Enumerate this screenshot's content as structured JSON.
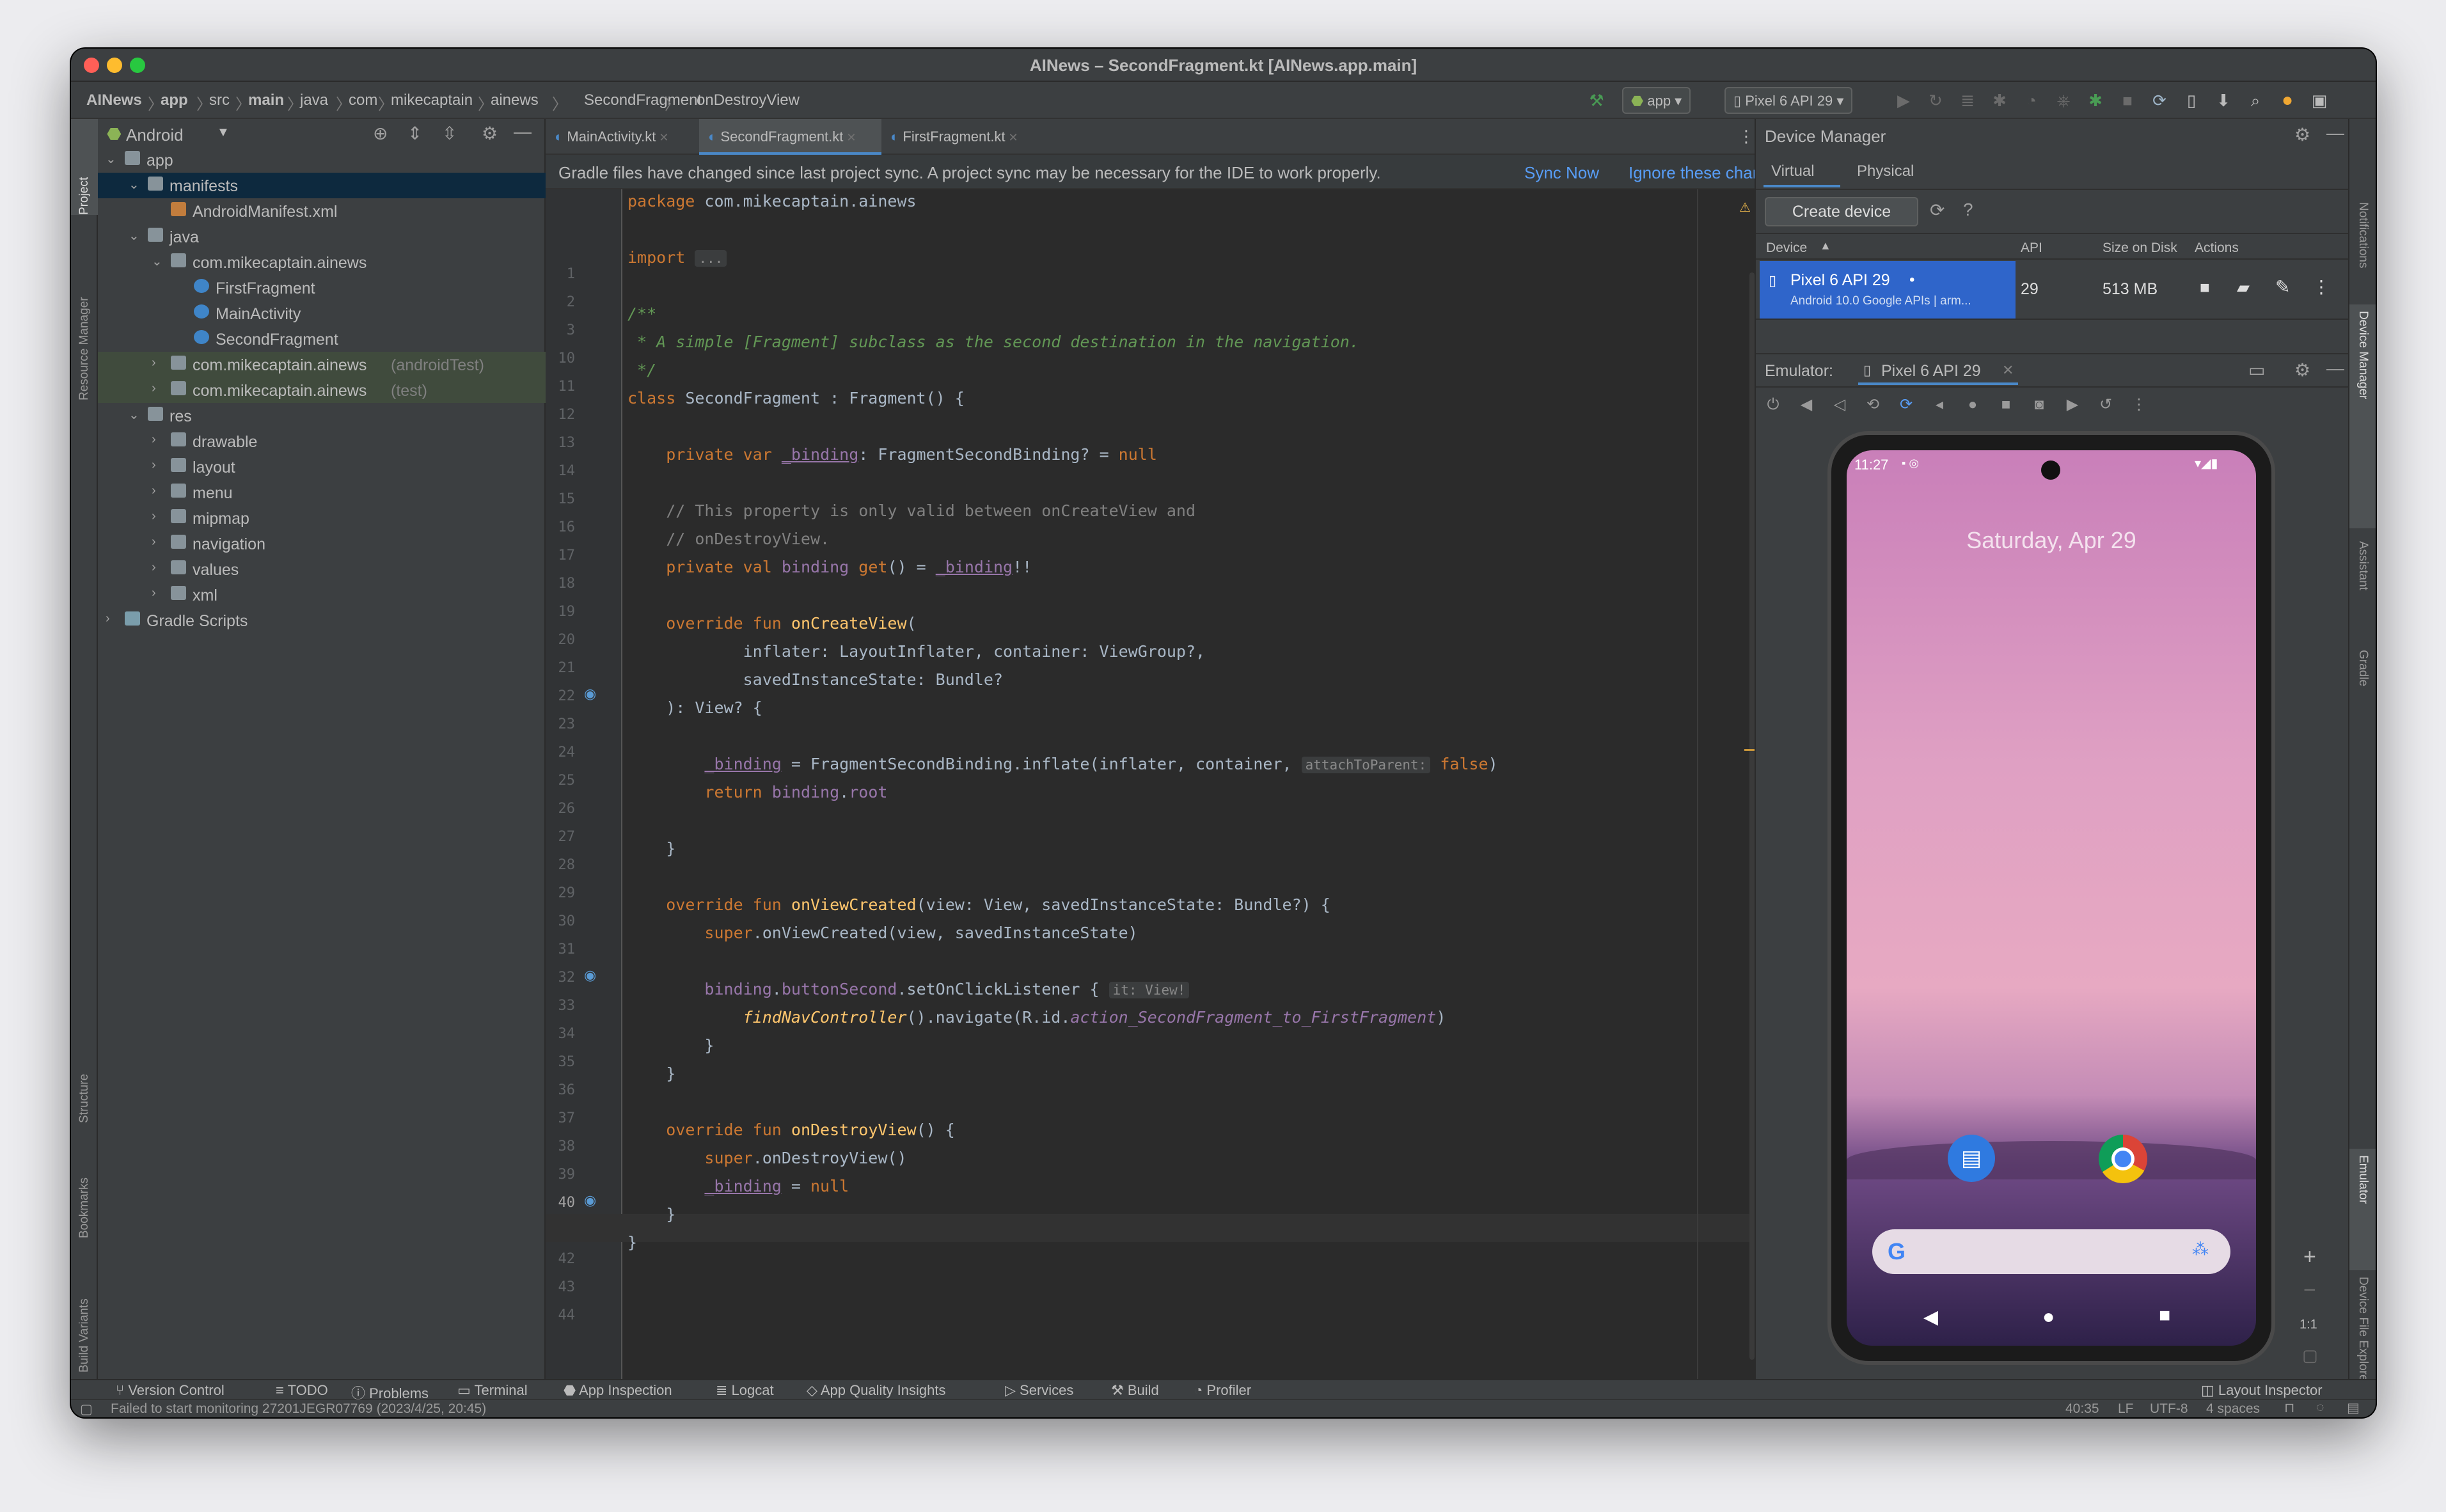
{
  "window": {
    "title": "AINews – SecondFragment.kt [AINews.app.main]"
  },
  "breadcrumbs": [
    "AINews",
    "app",
    "src",
    "main",
    "java",
    "com",
    "mikecaptain",
    "ainews",
    "SecondFragment",
    "onDestroyView"
  ],
  "run_config": "app",
  "device_selector": "Pixel 6 API 29",
  "left_tools": [
    "Project",
    "Resource Manager",
    "Structure",
    "Bookmarks",
    "Build Variants"
  ],
  "right_tools": [
    "Notifications",
    "Device Manager",
    "Assistant",
    "Gradle",
    "Emulator",
    "Device File Explorer"
  ],
  "project": {
    "view": "Android",
    "tree": [
      {
        "label": "app",
        "suffix": "",
        "depth": 0,
        "open": "v",
        "icon": "folder"
      },
      {
        "label": "manifests",
        "suffix": "",
        "depth": 1,
        "open": "v",
        "icon": "folder"
      },
      {
        "label": "AndroidManifest.xml",
        "suffix": "",
        "depth": 2,
        "open": "",
        "icon": "xml"
      },
      {
        "label": "java",
        "suffix": "",
        "depth": 1,
        "open": "v",
        "icon": "folder"
      },
      {
        "label": "com.mikecaptain.ainews",
        "suffix": "",
        "depth": 2,
        "open": "v",
        "icon": "folder"
      },
      {
        "label": "FirstFragment",
        "suffix": "",
        "depth": 3,
        "open": "",
        "icon": "kt"
      },
      {
        "label": "MainActivity",
        "suffix": "",
        "depth": 3,
        "open": "",
        "icon": "kt"
      },
      {
        "label": "SecondFragment",
        "suffix": "",
        "depth": 3,
        "open": "",
        "icon": "kt"
      },
      {
        "label": "com.mikecaptain.ainews",
        "suffix": "(androidTest)",
        "depth": 2,
        "open": ">",
        "icon": "folder"
      },
      {
        "label": "com.mikecaptain.ainews",
        "suffix": "(test)",
        "depth": 2,
        "open": ">",
        "icon": "folder"
      },
      {
        "label": "res",
        "suffix": "",
        "depth": 1,
        "open": "v",
        "icon": "folder"
      },
      {
        "label": "drawable",
        "suffix": "",
        "depth": 2,
        "open": ">",
        "icon": "folder"
      },
      {
        "label": "layout",
        "suffix": "",
        "depth": 2,
        "open": ">",
        "icon": "folder"
      },
      {
        "label": "menu",
        "suffix": "",
        "depth": 2,
        "open": ">",
        "icon": "folder"
      },
      {
        "label": "mipmap",
        "suffix": "",
        "depth": 2,
        "open": ">",
        "icon": "folder"
      },
      {
        "label": "navigation",
        "suffix": "",
        "depth": 2,
        "open": ">",
        "icon": "folder"
      },
      {
        "label": "values",
        "suffix": "",
        "depth": 2,
        "open": ">",
        "icon": "folder"
      },
      {
        "label": "xml",
        "suffix": "",
        "depth": 2,
        "open": ">",
        "icon": "folder"
      },
      {
        "label": "Gradle Scripts",
        "suffix": "",
        "depth": 0,
        "open": ">",
        "icon": "gradle"
      }
    ]
  },
  "tabs": [
    {
      "label": "MainActivity.kt",
      "active": false
    },
    {
      "label": "SecondFragment.kt",
      "active": true
    },
    {
      "label": "FirstFragment.kt",
      "active": false
    }
  ],
  "notice": {
    "text": "Gradle files have changed since last project sync. A project sync may be necessary for the IDE to work properly.",
    "sync": "Sync Now",
    "ignore": "Ignore these changes"
  },
  "warnings": "1",
  "code": [
    {
      "n": "1",
      "html": "<span class='kw'>package</span> com.mikecaptain.ainews"
    },
    {
      "n": "2",
      "html": ""
    },
    {
      "n": "3",
      "html": "<span class='kw'>import</span> <span class='hint'>...</span>"
    },
    {
      "n": "10",
      "html": ""
    },
    {
      "n": "11",
      "html": "<span class='dc'>/**</span>"
    },
    {
      "n": "12",
      "html": "<span class='dc'> * A simple [Fragment] subclass as the second destination in the navigation.</span>"
    },
    {
      "n": "13",
      "html": "<span class='dc'> */</span>"
    },
    {
      "n": "14",
      "html": "<span class='kw'>class</span> SecondFragment : Fragment() {"
    },
    {
      "n": "15",
      "html": ""
    },
    {
      "n": "16",
      "html": "    <span class='kw'>private var</span> <span class='pr un'>_binding</span>: FragmentSecondBinding? = <span class='kw'>null</span>"
    },
    {
      "n": "17",
      "html": ""
    },
    {
      "n": "18",
      "html": "    <span class='cm'>// This property is only valid between onCreateView and</span>"
    },
    {
      "n": "19",
      "html": "    <span class='cm'>// onDestroyView.</span>"
    },
    {
      "n": "20",
      "html": "    <span class='kw'>private val</span> <span class='pr'>binding</span> <span class='kw'>get</span>() = <span class='pr un'>_binding</span>!!"
    },
    {
      "n": "21",
      "html": ""
    },
    {
      "n": "22",
      "html": "    <span class='kw'>override fun</span> <span class='fn'>onCreateView</span>("
    },
    {
      "n": "23",
      "html": "            inflater: LayoutInflater, container: ViewGroup?,"
    },
    {
      "n": "24",
      "html": "            savedInstanceState: Bundle?"
    },
    {
      "n": "25",
      "html": "    ): View? {"
    },
    {
      "n": "26",
      "html": ""
    },
    {
      "n": "27",
      "html": "        <span class='pr un'>_binding</span> = FragmentSecondBinding.inflate(inflater, container, <span class='hint'>attachToParent:</span> <span class='kw'>false</span>)"
    },
    {
      "n": "28",
      "html": "        <span class='kw'>return</span> <span class='pr'>binding</span>.<span class='pr'>root</span>"
    },
    {
      "n": "29",
      "html": ""
    },
    {
      "n": "30",
      "html": "    }"
    },
    {
      "n": "31",
      "html": ""
    },
    {
      "n": "32",
      "html": "    <span class='kw'>override fun</span> <span class='fn'>onViewCreated</span>(view: View, savedInstanceState: Bundle?) {"
    },
    {
      "n": "33",
      "html": "        <span class='kw'>super</span>.onViewCreated(view, savedInstanceState)"
    },
    {
      "n": "34",
      "html": ""
    },
    {
      "n": "35",
      "html": "        <span class='pr'>binding</span>.<span class='pr'>buttonSecond</span>.setOnClickListener { <span class='hint'>it: View!</span>"
    },
    {
      "n": "36",
      "html": "            <span class='fn it'>findNavController</span>().navigate(R.id.<span class='pr it'>action_SecondFragment_to_FirstFragment</span>)"
    },
    {
      "n": "37",
      "html": "        }"
    },
    {
      "n": "38",
      "html": "    }"
    },
    {
      "n": "39",
      "html": ""
    },
    {
      "n": "40",
      "html": "    <span class='kw'>override fun</span> <span class='fn'>onDestroyView</span>() {"
    },
    {
      "n": "41",
      "html": "        <span class='kw'>super</span>.onDestroyView()"
    },
    {
      "n": "42",
      "html": "        <span class='pr un'>_binding</span> = <span class='kw'>null</span>"
    },
    {
      "n": "43",
      "html": "    }"
    },
    {
      "n": "44",
      "html": "}"
    }
  ],
  "device_manager": {
    "title": "Device Manager",
    "tab_virtual": "Virtual",
    "tab_physical": "Physical",
    "create": "Create device",
    "col_device": "Device",
    "col_api": "API",
    "col_size": "Size on Disk",
    "col_actions": "Actions",
    "device_name": "Pixel 6 API 29",
    "device_sub": "Android 10.0 Google APIs | arm...",
    "api": "29",
    "size": "513 MB"
  },
  "emulator": {
    "label": "Emulator:",
    "tab": "Pixel 6 API 29",
    "time": "11:27",
    "date": "Saturday, Apr 29",
    "zoom_ratio": "1:1"
  },
  "bottom_tools": [
    "Version Control",
    "TODO",
    "Problems",
    "Terminal",
    "App Inspection",
    "Logcat",
    "App Quality Insights",
    "Services",
    "Build",
    "Profiler"
  ],
  "layout_inspector": "Layout Inspector",
  "status": {
    "message": "Failed to start monitoring 27201JEGR07769 (2023/4/25, 20:45)",
    "position": "40:35",
    "line_sep": "LF",
    "encoding": "UTF-8",
    "indent": "4 spaces"
  }
}
